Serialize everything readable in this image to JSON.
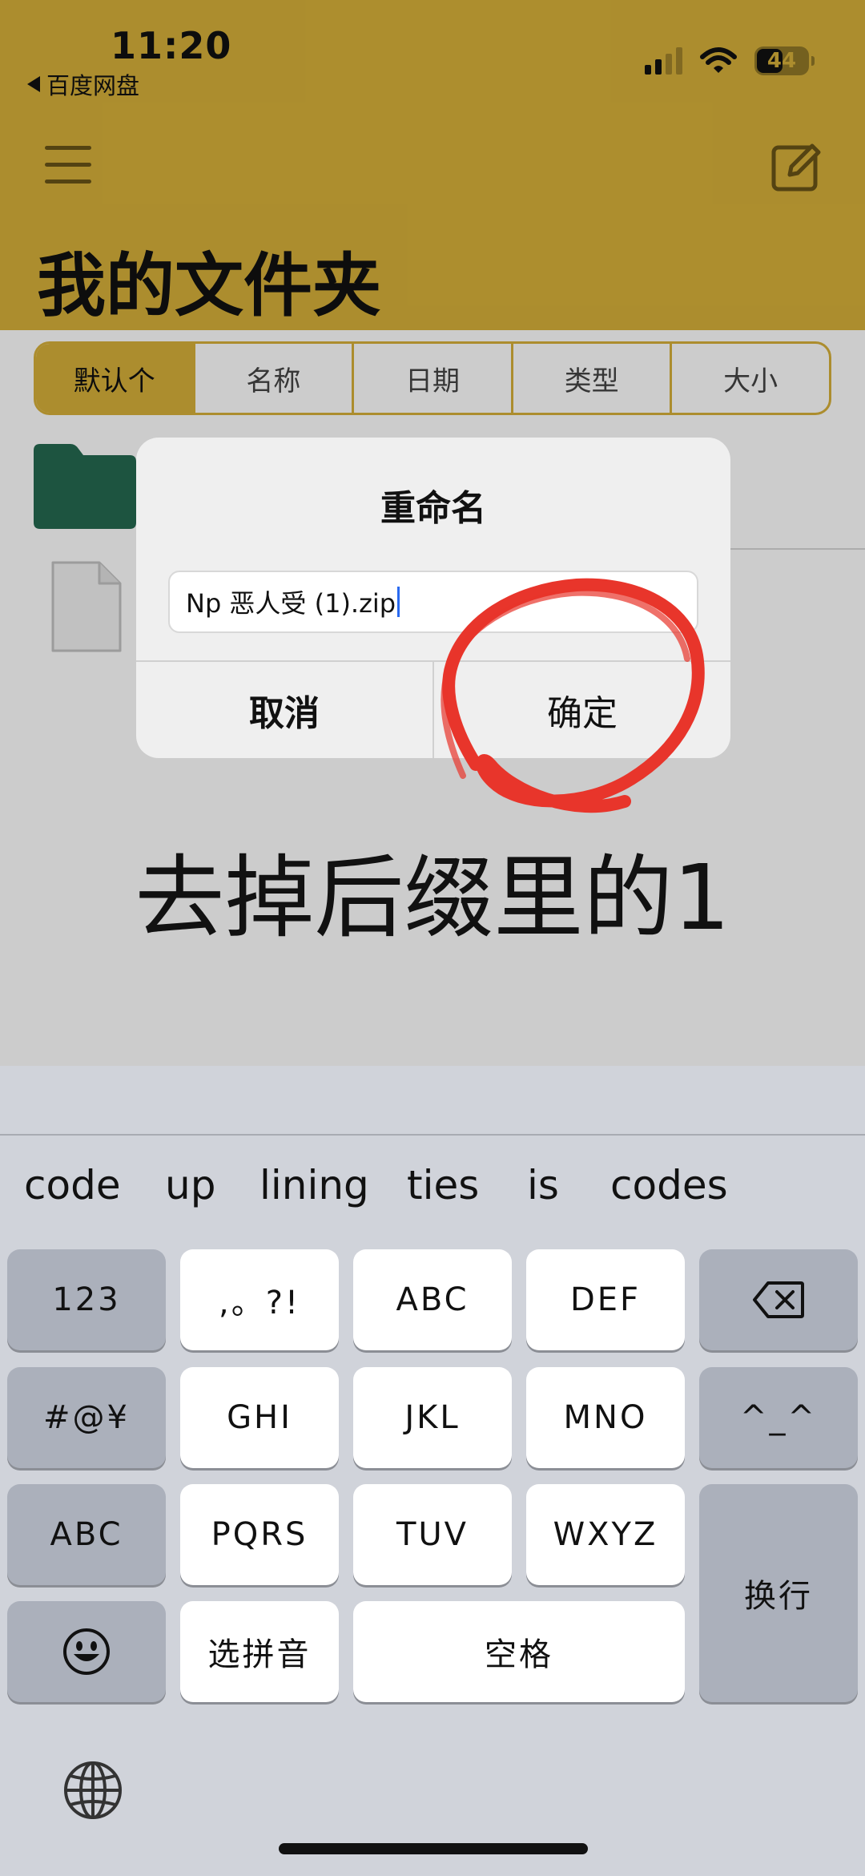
{
  "status_bar": {
    "time": "11:20",
    "back_app": "百度网盘",
    "battery": "44"
  },
  "header": {
    "title": "我的文件夹"
  },
  "sort_bar": {
    "options": [
      "默认个",
      "名称",
      "日期",
      "类型",
      "大小"
    ]
  },
  "dialog": {
    "title": "重命名",
    "input_value": "Np 恶人受 (1).zip",
    "cancel_label": "取消",
    "confirm_label": "确定"
  },
  "annotation": {
    "text": "去掉后缀里的1",
    "circle_color": "#e8352b"
  },
  "keyboard": {
    "suggestions": [
      "code",
      "up",
      "lining",
      "ties",
      "is",
      "codes"
    ],
    "keys": {
      "num": "123",
      "punct": ",。?!",
      "abc_key": "ABC",
      "def": "DEF",
      "symbols": "#@¥",
      "ghi": "GHI",
      "jkl": "JKL",
      "mno": "MNO",
      "kaomoji": "^_^",
      "abc_switch": "ABC",
      "pqrs": "PQRS",
      "tuv": "TUV",
      "wxyz": "WXYZ",
      "return": "换行",
      "pinyin": "选拼音",
      "space": "空格"
    }
  },
  "colors": {
    "accent": "#d8b13a",
    "folder": "#256a50",
    "caret": "#2a6af0"
  }
}
